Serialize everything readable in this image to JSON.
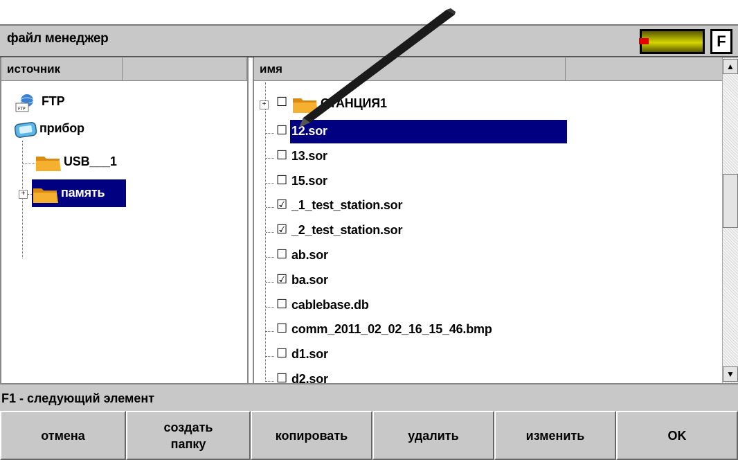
{
  "window": {
    "title": "файл менеджер",
    "function_key": "F"
  },
  "left": {
    "header": "источник",
    "items": [
      {
        "label": "FTP",
        "icon": "ftp-icon"
      },
      {
        "label": "прибор",
        "icon": "device-icon"
      },
      {
        "label": "USB___1",
        "icon": "folder-icon"
      },
      {
        "label": "память",
        "icon": "folder-icon",
        "selected": true
      }
    ]
  },
  "right": {
    "header": "имя",
    "folder": {
      "label": "СТАНЦИЯ1",
      "checked": false
    },
    "files": [
      {
        "label": "12.sor",
        "checked": false,
        "selected": true
      },
      {
        "label": "13.sor",
        "checked": false
      },
      {
        "label": "15.sor",
        "checked": false
      },
      {
        "label": "_1_test_station.sor",
        "checked": true
      },
      {
        "label": "_2_test_station.sor",
        "checked": true
      },
      {
        "label": "ab.sor",
        "checked": false
      },
      {
        "label": "ba.sor",
        "checked": true
      },
      {
        "label": "cablebase.db",
        "checked": false
      },
      {
        "label": "comm_2011_02_02_16_15_46.bmp",
        "checked": false
      },
      {
        "label": "d1.sor",
        "checked": false
      },
      {
        "label": "d2.sor",
        "checked": false
      }
    ]
  },
  "status": "F1 - следующий элемент",
  "buttons": {
    "cancel": "отмена",
    "create_folder_1": "создать",
    "create_folder_2": "папку",
    "copy": "копировать",
    "delete": "удалить",
    "rename": "изменить",
    "ok": "OK"
  },
  "colors": {
    "selection": "#000080",
    "panel": "#c8c8c8",
    "folder": "#f5a623"
  }
}
